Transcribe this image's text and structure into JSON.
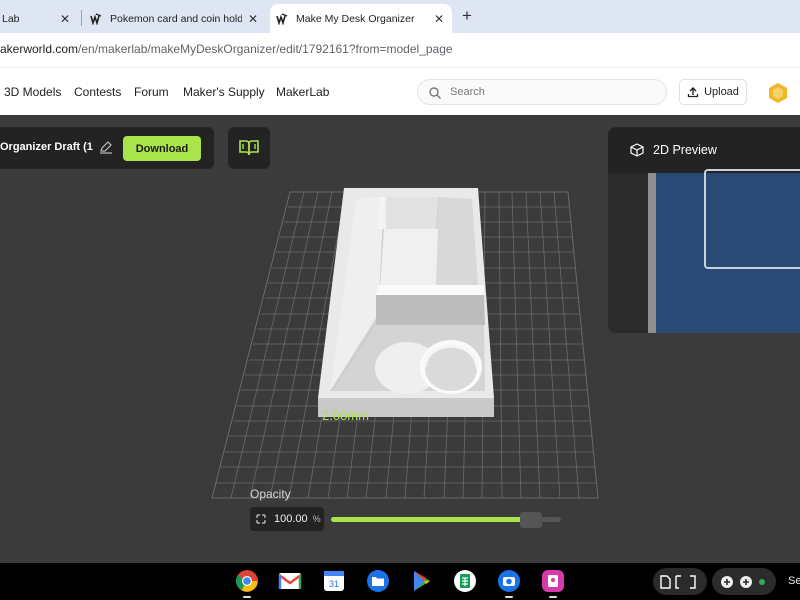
{
  "browser": {
    "tabs": [
      {
        "label": "Lab",
        "active": false
      },
      {
        "label": "Pokemon card and coin holder",
        "active": false
      },
      {
        "label": "Make My Desk Organizer",
        "active": true
      }
    ],
    "new_tab_label": "+",
    "close_glyph": "✕",
    "url_host": "akerworld.com",
    "url_path": "/en/makerlab/makeMyDeskOrganizer/edit/1792161?from=model_page"
  },
  "site_nav": {
    "links": [
      "3D Models",
      "Contests",
      "Forum",
      "Maker's Supply",
      "MakerLab"
    ],
    "search_placeholder": "Search",
    "upload_label": "Upload"
  },
  "editor": {
    "draft_title": "Organizer Draft (1",
    "download_label": "Download",
    "dimension_label": "2.00mm",
    "preview_title": "2D Preview",
    "opacity_label": "Opacity",
    "opacity_value": "100.00",
    "opacity_unit": "%",
    "opacity_fraction": 0.91
  },
  "shelf": {
    "apps": [
      "chrome-icon",
      "gmail-icon",
      "calendar-icon",
      "files-icon",
      "play-store-icon",
      "sheets-icon",
      "camera-icon",
      "gallery-icon"
    ],
    "status_text": "Se"
  },
  "colors": {
    "accent": "#a9e44b",
    "workspace_bg": "#3b3b3b",
    "panel_bg": "#232323",
    "preview_canvas": "#2a4975"
  }
}
